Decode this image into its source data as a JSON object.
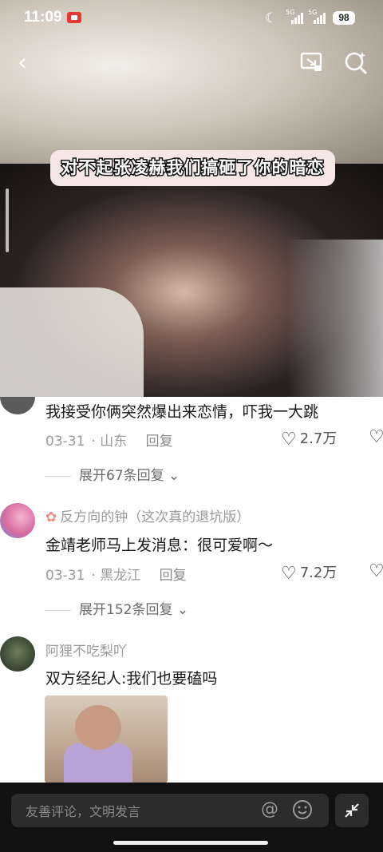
{
  "status_bar": {
    "time": "11:09",
    "battery": "98",
    "sig1": "5G",
    "sig2": "5G"
  },
  "video": {
    "caption": "对不起张凌赫我们搞砸了你的暗恋"
  },
  "comments": [
    {
      "text": "我接受你俩突然爆出来恋情，吓我一大跳",
      "date": "03-31",
      "location": "山东",
      "reply": "回复",
      "likes": "2.7万",
      "expand": "展开67条回复"
    },
    {
      "username": "反方向的钟（这次真的退坑版）",
      "text": "金靖老师马上发消息：很可爱啊～",
      "date": "03-31",
      "location": "黑龙江",
      "reply": "回复",
      "likes": "7.2万",
      "expand": "展开152条回复"
    },
    {
      "username": "阿狸不吃梨吖",
      "text": "双方经纪人:我们也要磕吗"
    }
  ],
  "input": {
    "placeholder": "友善评论，文明发言"
  },
  "colors": {
    "caption_bg": "#f7e6e6",
    "comment_bg": "#ffffff",
    "bottom_bar": "#111111"
  }
}
